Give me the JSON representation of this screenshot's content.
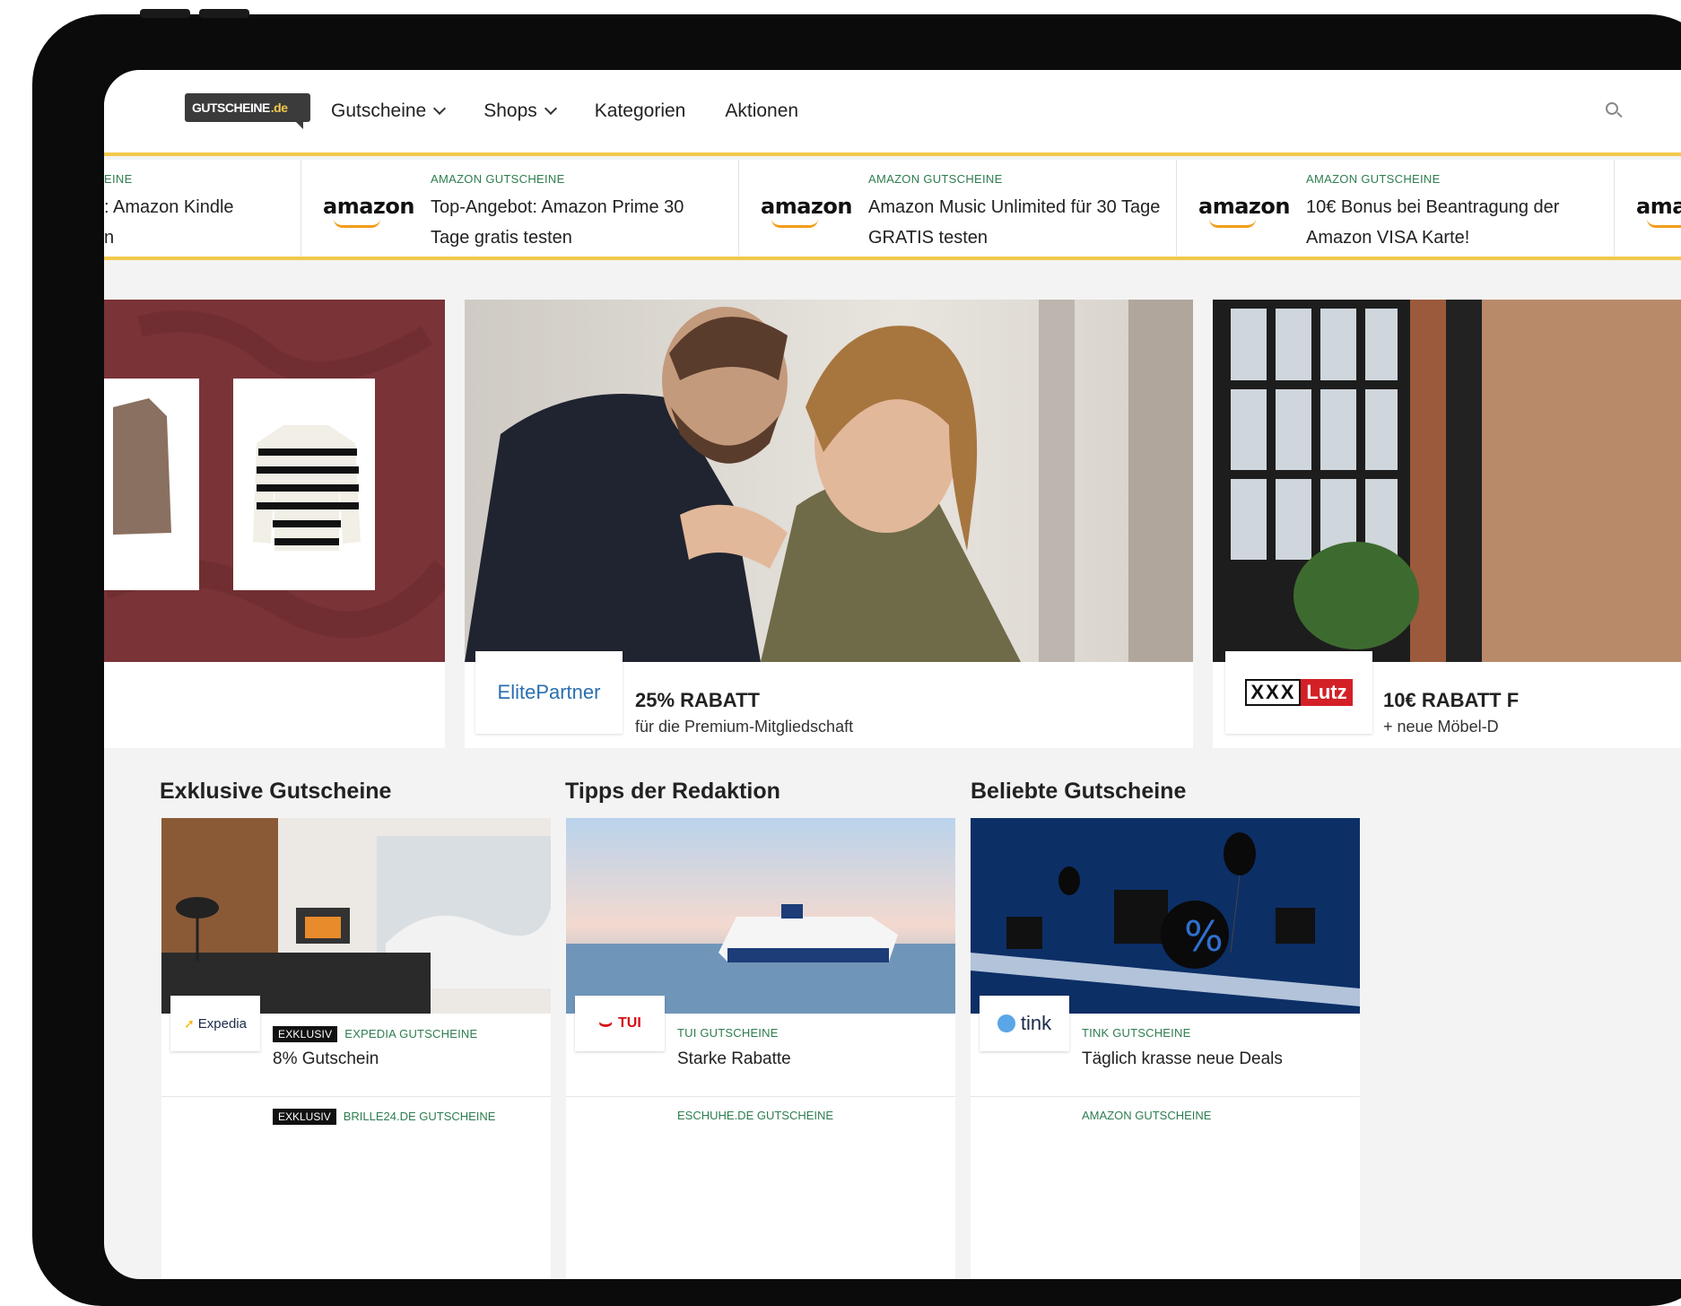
{
  "header": {
    "logo_text": "GUTSCHEINE",
    "logo_suffix": ".de",
    "nav": [
      {
        "label": "Gutscheine",
        "dropdown": true
      },
      {
        "label": "Shops",
        "dropdown": true
      },
      {
        "label": "Kategorien",
        "dropdown": false
      },
      {
        "label": "Aktionen",
        "dropdown": false
      }
    ]
  },
  "ticker": [
    {
      "brand": "",
      "category": "EINE",
      "title": ": Amazon Kindle\nn"
    },
    {
      "brand": "amazon",
      "category": "AMAZON GUTSCHEINE",
      "title": "Top-Angebot: Amazon Prime 30 Tage gratis testen"
    },
    {
      "brand": "amazon",
      "category": "AMAZON GUTSCHEINE",
      "title": "Amazon Music Unlimited für 30 Tage GRATIS testen"
    },
    {
      "brand": "amazon",
      "category": "AMAZON GUTSCHEINE",
      "title": "10€ Bonus bei Beantragung der Amazon VISA Karte!"
    },
    {
      "brand": "amazo",
      "category": "",
      "title": ""
    }
  ],
  "hero": [
    {
      "brand": "",
      "title": "",
      "subtitle": ""
    },
    {
      "brand": "ElitePartner",
      "title": "25% RABATT",
      "subtitle": "für die Premium-Mitgliedschaft"
    },
    {
      "brand_left": "XXX",
      "brand_right": "Lutz",
      "title": "10€ RABATT F",
      "subtitle": "+ neue Möbel-D"
    }
  ],
  "sections": [
    {
      "heading": "Exklusive Gutscheine",
      "logo": "Expedia",
      "badge": "EXKLUSIV",
      "category": "EXPEDIA GUTSCHEINE",
      "title": "8% Gutschein",
      "badge2": "EXKLUSIV",
      "category2": "BRILLE24.DE GUTSCHEINE"
    },
    {
      "heading": "Tipps der Redaktion",
      "logo": "TUI",
      "badge": "",
      "category": "TUI GUTSCHEINE",
      "title": "Starke Rabatte",
      "badge2": "",
      "category2": "ESCHUHE.DE GUTSCHEINE"
    },
    {
      "heading": "Beliebte Gutscheine",
      "logo": "tink",
      "badge": "",
      "category": "TINK GUTSCHEINE",
      "title": "Täglich krasse neue Deals",
      "badge2": "",
      "category2": "AMAZON GUTSCHEINE"
    }
  ],
  "colors": {
    "accent": "#f2c94c",
    "category_green": "#2e7d4f",
    "xxxlutz_red": "#d32027"
  }
}
